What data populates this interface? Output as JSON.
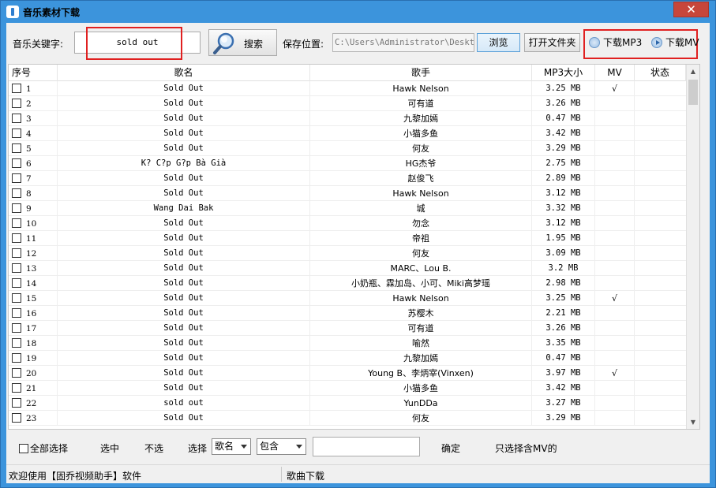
{
  "window": {
    "title": "音乐素材下载",
    "close_label": "✕"
  },
  "toolbar": {
    "keyword_label": "音乐关键字:",
    "keyword_value": "sold out",
    "search_label": "搜索",
    "save_label": "保存位置:",
    "save_path": "C:\\Users\\Administrator\\Desktop",
    "browse_label": "浏览",
    "open_folder_label": "打开文件夹",
    "download_mp3_label": "下载MP3",
    "download_mv_label": "下载MV"
  },
  "table": {
    "headers": {
      "no": "序号",
      "name": "歌名",
      "artist": "歌手",
      "size": "MP3大小",
      "mv": "MV",
      "state": "状态"
    },
    "rows": [
      {
        "no": "1",
        "name": "Sold Out",
        "artist": "Hawk Nelson",
        "size": "3.25 MB",
        "mv": "√"
      },
      {
        "no": "2",
        "name": "Sold Out",
        "artist": "可有道",
        "size": "3.26 MB",
        "mv": ""
      },
      {
        "no": "3",
        "name": "Sold Out",
        "artist": "九黎加嫣",
        "size": "0.47 MB",
        "mv": ""
      },
      {
        "no": "4",
        "name": "Sold Out",
        "artist": "小猫多鱼",
        "size": "3.42 MB",
        "mv": ""
      },
      {
        "no": "5",
        "name": "Sold Out",
        "artist": "何友",
        "size": "3.29 MB",
        "mv": ""
      },
      {
        "no": "6",
        "name": "K? C?p G?p Bà Già",
        "artist": "HG杰爷",
        "size": "2.75 MB",
        "mv": ""
      },
      {
        "no": "7",
        "name": "Sold Out",
        "artist": "赵俊飞",
        "size": "2.89 MB",
        "mv": ""
      },
      {
        "no": "8",
        "name": "Sold Out",
        "artist": "Hawk Nelson",
        "size": "3.12 MB",
        "mv": ""
      },
      {
        "no": "9",
        "name": "Wang Dai Bak",
        "artist": "城",
        "size": "3.32 MB",
        "mv": ""
      },
      {
        "no": "10",
        "name": "Sold Out",
        "artist": "勿念",
        "size": "3.12 MB",
        "mv": ""
      },
      {
        "no": "11",
        "name": "Sold Out",
        "artist": "帝祖",
        "size": "1.95 MB",
        "mv": ""
      },
      {
        "no": "12",
        "name": "Sold Out",
        "artist": "何友",
        "size": "3.09 MB",
        "mv": ""
      },
      {
        "no": "13",
        "name": "Sold Out",
        "artist": "MARC、Lou B.",
        "size": "3.2 MB",
        "mv": ""
      },
      {
        "no": "14",
        "name": "Sold Out",
        "artist": "小奶瓶、霖加岛、小可、Miki高梦瑶",
        "size": "2.98 MB",
        "mv": ""
      },
      {
        "no": "15",
        "name": "Sold Out",
        "artist": "Hawk Nelson",
        "size": "3.25 MB",
        "mv": "√"
      },
      {
        "no": "16",
        "name": "Sold Out",
        "artist": "苏樱木",
        "size": "2.21 MB",
        "mv": ""
      },
      {
        "no": "17",
        "name": "Sold Out",
        "artist": "可有道",
        "size": "3.26 MB",
        "mv": ""
      },
      {
        "no": "18",
        "name": "Sold Out",
        "artist": "喻然",
        "size": "3.35 MB",
        "mv": ""
      },
      {
        "no": "19",
        "name": "Sold Out",
        "artist": "九黎加嫣",
        "size": "0.47 MB",
        "mv": ""
      },
      {
        "no": "20",
        "name": "Sold Out",
        "artist": "Young B、李炳宰(Vinxen)",
        "size": "3.97 MB",
        "mv": "√"
      },
      {
        "no": "21",
        "name": "Sold Out",
        "artist": "小猫多鱼",
        "size": "3.42 MB",
        "mv": ""
      },
      {
        "no": "22",
        "name": "sold out",
        "artist": "YunDDa",
        "size": "3.27 MB",
        "mv": ""
      },
      {
        "no": "23",
        "name": "Sold Out",
        "artist": "何友",
        "size": "3.29 MB",
        "mv": ""
      }
    ]
  },
  "filter": {
    "select_all_label": "全部选择",
    "select_label": "选中",
    "deselect_label": "不选",
    "choose_label": "选择",
    "field_value": "歌名",
    "match_value": "包含",
    "filter_text": "",
    "confirm_label": "确定",
    "mv_only_label": "只选择含MV的"
  },
  "status": {
    "left": "欢迎使用【固乔视频助手】软件",
    "right": "歌曲下载"
  }
}
